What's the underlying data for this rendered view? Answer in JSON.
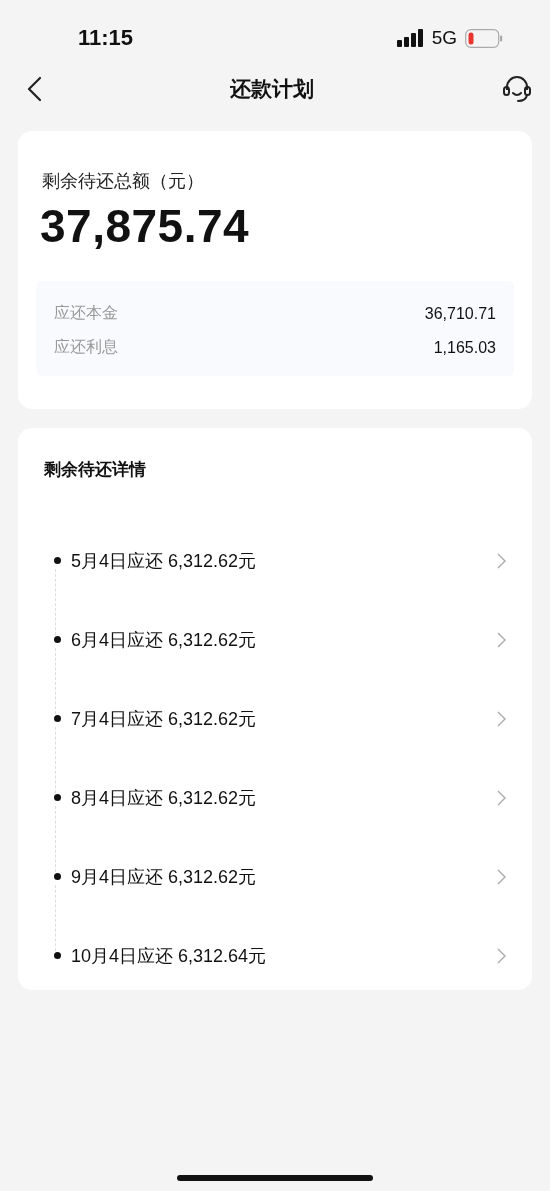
{
  "status_bar": {
    "time": "11:15",
    "network": "5G"
  },
  "nav": {
    "title": "还款计划"
  },
  "summary": {
    "label": "剩余待还总额（元）",
    "amount": "37,875.74",
    "items": [
      {
        "label": "应还本金",
        "value": "36,710.71"
      },
      {
        "label": "应还利息",
        "value": "1,165.03"
      }
    ]
  },
  "details": {
    "title": "剩余待还详情",
    "items": [
      {
        "text": "5月4日应还 6,312.62元"
      },
      {
        "text": "6月4日应还 6,312.62元"
      },
      {
        "text": "7月4日应还 6,312.62元"
      },
      {
        "text": "8月4日应还 6,312.62元"
      },
      {
        "text": "9月4日应还 6,312.62元"
      },
      {
        "text": "10月4日应还 6,312.64元"
      }
    ]
  }
}
